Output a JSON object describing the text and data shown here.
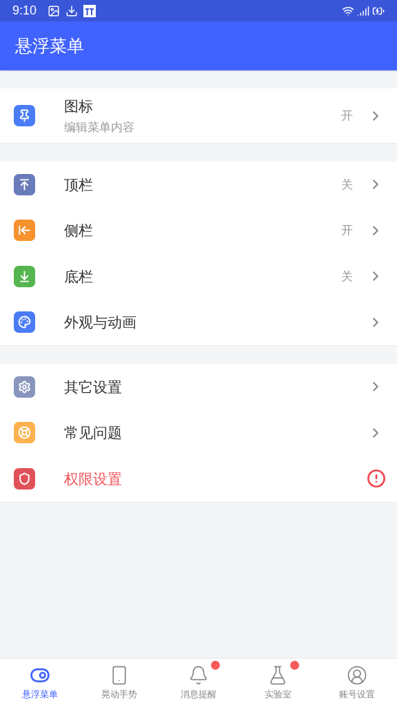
{
  "status_bar": {
    "time": "9:10"
  },
  "app_bar": {
    "title": "悬浮菜单"
  },
  "sections": [
    {
      "items": [
        {
          "kind": "nav",
          "title": "图标",
          "subtitle": "编辑菜单内容",
          "status": "开",
          "color": "#4a7cf6"
        }
      ]
    },
    {
      "items": [
        {
          "kind": "nav",
          "title": "顶栏",
          "status": "关",
          "color": "#6a7bba"
        },
        {
          "kind": "nav",
          "title": "侧栏",
          "status": "开",
          "color": "#f7922e"
        },
        {
          "kind": "nav",
          "title": "底栏",
          "status": "关",
          "color": "#55b54f"
        },
        {
          "kind": "nav",
          "title": "外观与动画",
          "color": "#4a7cf6"
        }
      ]
    },
    {
      "items": [
        {
          "kind": "nav",
          "title": "其它设置",
          "color": "#8896bd"
        },
        {
          "kind": "nav",
          "title": "常见问题",
          "color": "#fdb24f"
        },
        {
          "kind": "alert",
          "title": "权限设置",
          "color": "#e0525a"
        }
      ]
    }
  ],
  "bottom_nav": [
    {
      "label": "悬浮菜单",
      "selected": true,
      "badge": false
    },
    {
      "label": "晃动手势",
      "selected": false,
      "badge": false
    },
    {
      "label": "消息提醒",
      "selected": false,
      "badge": true
    },
    {
      "label": "实验室",
      "selected": false,
      "badge": true
    },
    {
      "label": "账号设置",
      "selected": false,
      "badge": false
    }
  ]
}
